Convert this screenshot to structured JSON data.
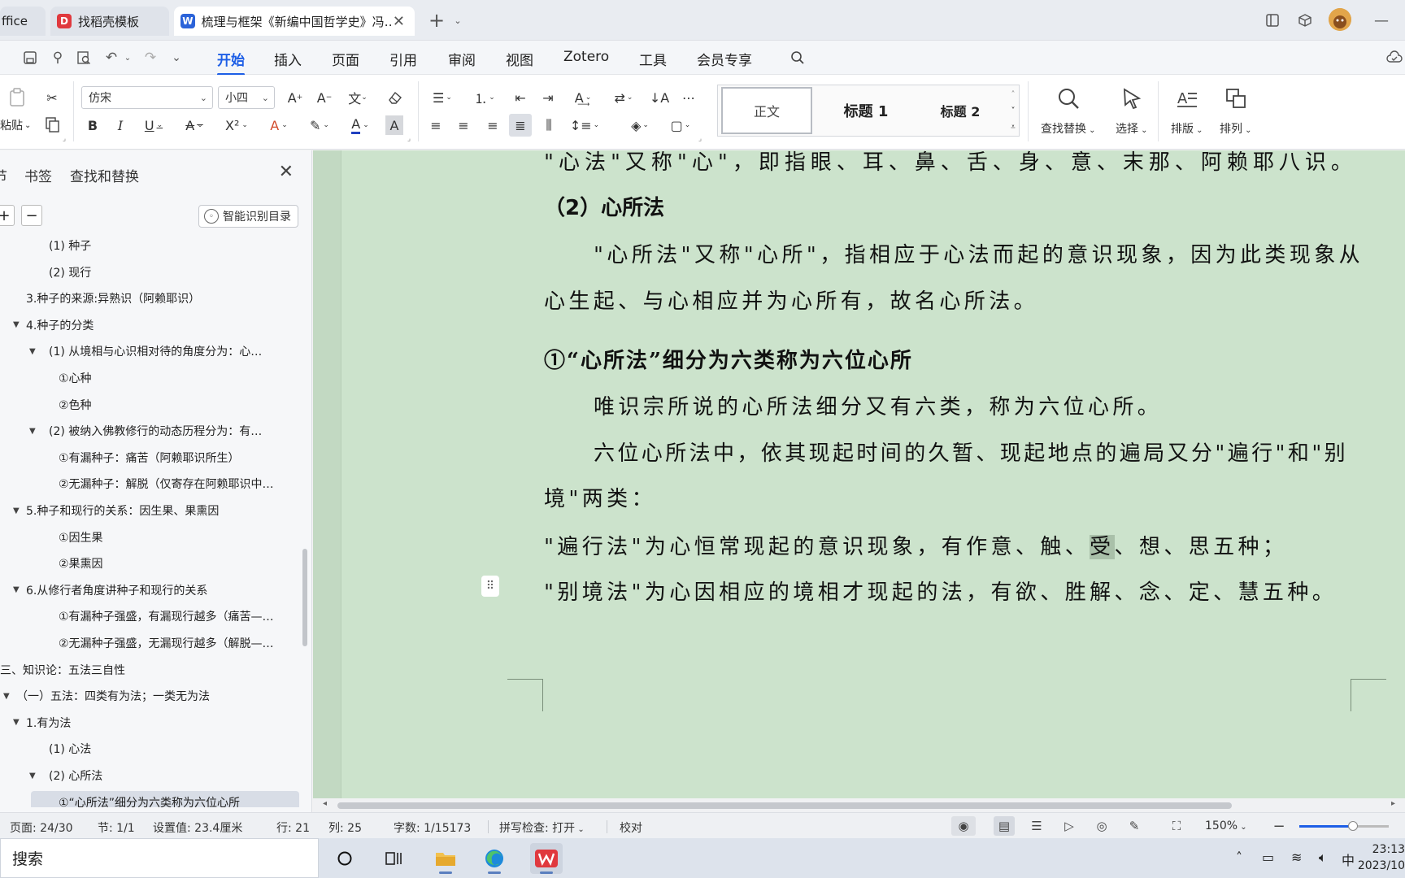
{
  "tabs": [
    {
      "label": "ffice",
      "icon": ""
    },
    {
      "label": "找稻壳模板",
      "icon": "D"
    },
    {
      "label": "梳理与框架《新编中国哲学史》冯…",
      "icon": "W"
    }
  ],
  "menu": {
    "items": [
      "开始",
      "插入",
      "页面",
      "引用",
      "审阅",
      "视图",
      "Zotero",
      "工具",
      "会员专享"
    ],
    "active": "开始"
  },
  "ribbon": {
    "paste_label": "粘贴",
    "font_name": "仿宋",
    "font_size": "小四",
    "styles": [
      "正文",
      "标题 1",
      "标题 2"
    ],
    "find_replace_label": "查找替换",
    "select_label": "选择",
    "typeset_label": "排版",
    "arrange_label": "排列"
  },
  "nav": {
    "tabs": [
      "节",
      "书签",
      "查找和替换"
    ],
    "ai_button": "智能识别目录",
    "items": [
      {
        "text": "(1) 种子",
        "level": 3,
        "expanded": null
      },
      {
        "text": "(2) 现行",
        "level": 3,
        "expanded": null
      },
      {
        "text": "3.种子的来源:异熟识（阿赖耶识）",
        "level": 2,
        "expanded": null
      },
      {
        "text": "4.种子的分类",
        "level": 2,
        "expanded": true
      },
      {
        "text": "(1) 从境相与心识相对待的角度分为：心…",
        "level": 3,
        "expanded": true
      },
      {
        "text": "①心种",
        "level": 4,
        "expanded": null
      },
      {
        "text": "②色种",
        "level": 4,
        "expanded": null
      },
      {
        "text": "(2) 被纳入佛教修行的动态历程分为：有…",
        "level": 3,
        "expanded": true
      },
      {
        "text": "①有漏种子：痛苦（阿赖耶识所生）",
        "level": 4,
        "expanded": null
      },
      {
        "text": "②无漏种子：解脱（仅寄存在阿赖耶识中…",
        "level": 4,
        "expanded": null
      },
      {
        "text": "5.种子和现行的关系：因生果、果熏因",
        "level": 2,
        "expanded": true
      },
      {
        "text": "①因生果",
        "level": 4,
        "expanded": null
      },
      {
        "text": "②果熏因",
        "level": 4,
        "expanded": null
      },
      {
        "text": "6.从修行者角度讲种子和现行的关系",
        "level": 2,
        "expanded": true
      },
      {
        "text": "①有漏种子强盛，有漏现行越多（痛苦—…",
        "level": 4,
        "expanded": null
      },
      {
        "text": "②无漏种子强盛，无漏现行越多（解脱—…",
        "level": 4,
        "expanded": null
      },
      {
        "text": "三、知识论：五法三自性",
        "level": 0,
        "expanded": null
      },
      {
        "text": "（一）五法：四类有为法；一类无为法",
        "level": 1,
        "expanded": true
      },
      {
        "text": "1.有为法",
        "level": 2,
        "expanded": true
      },
      {
        "text": "(1) 心法",
        "level": 3,
        "expanded": null
      },
      {
        "text": "(2) 心所法",
        "level": 3,
        "expanded": true
      },
      {
        "text": "①“心所法”细分为六类称为六位心所",
        "level": 4,
        "expanded": null,
        "selected": true
      }
    ]
  },
  "document": {
    "line_top": "\"心法\"又称\"心\"，即指眼、耳、鼻、舌、身、意、末那、阿赖耶八识。",
    "heading": "（2）心所法",
    "para1_line1": "\"心所法\"又称\"心所\"，指相应于心法而起的意识现象，因为此类现象从",
    "para1_line2": "心生起、与心相应并为心所有，故名心所法。",
    "subheading": "①“心所法”细分为六类称为六位心所",
    "para2": "唯识宗所说的心所法细分又有六类，称为六位心所。",
    "para3_line1": "六位心所法中，依其现起时间的久暂、现起地点的遍局又分\"遍行\"和\"别",
    "para3_line2": "境\"两类：",
    "para4_pre": "\"遍行法\"为心恒常现起的意识现象，有作意、触、",
    "para4_hl": "受",
    "para4_post": "、想、思五种；",
    "para5": "\"别境法\"为心因相应的境相才现起的法，有欲、胜解、念、定、慧五种。"
  },
  "status": {
    "page": "页面: 24/30",
    "section": "节: 1/1",
    "setting": "设置值: 23.4厘米",
    "row": "行: 21",
    "col": "列: 25",
    "words": "字数: 1/15173",
    "spell": "拼写检查: 打开",
    "proof": "校对",
    "zoom": "150%",
    "zoom_fraction": 0.6
  },
  "taskbar": {
    "search": "搜索",
    "ime": "中",
    "time": "23:13",
    "date": "2023/10"
  },
  "colors": {
    "accent": "#1d5ee6",
    "doc_bg": "#cce3cc",
    "wps_red": "#e0393e"
  }
}
